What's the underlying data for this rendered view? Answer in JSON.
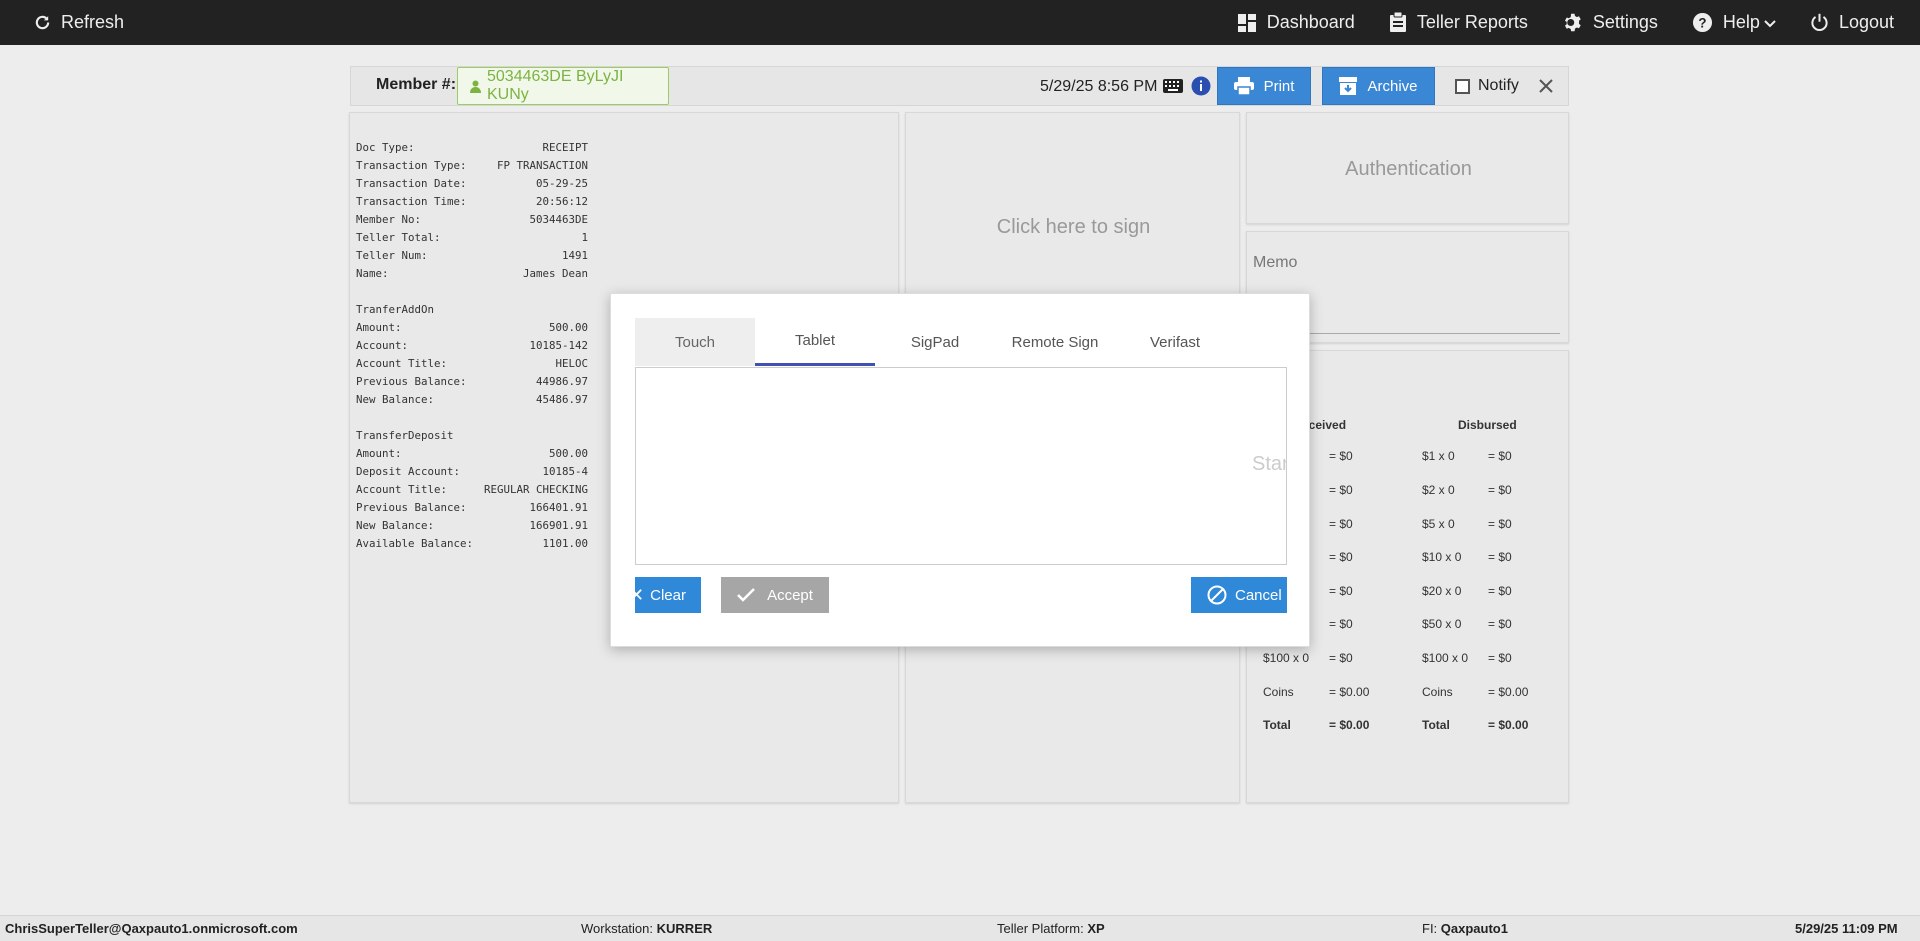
{
  "topbar": {
    "refresh_label": "Refresh",
    "nav": {
      "dashboard": "Dashboard",
      "teller_reports": "Teller Reports",
      "settings": "Settings",
      "help": "Help",
      "logout": "Logout"
    }
  },
  "member_bar": {
    "label": "Member #:",
    "member_chip": "5034463DE ByLyJI KUNy",
    "datetime": "5/29/25 8:56 PM",
    "print_label": "Print",
    "archive_label": "Archive",
    "notify_label": "Notify"
  },
  "receipt": {
    "rows1": [
      {
        "k": "Doc Type:",
        "v": "RECEIPT"
      },
      {
        "k": "Transaction Type:",
        "v": "FP TRANSACTION"
      },
      {
        "k": "Transaction Date:",
        "v": "05-29-25"
      },
      {
        "k": "Transaction Time:",
        "v": "20:56:12"
      },
      {
        "k": "Member No:",
        "v": "5034463DE"
      },
      {
        "k": "Teller Total:",
        "v": "1"
      },
      {
        "k": "Teller Num:",
        "v": "1491"
      },
      {
        "k": "Name:",
        "v": "James Dean"
      }
    ],
    "section2_title": "TranferAddOn",
    "rows2": [
      {
        "k": "Amount:",
        "v": "500.00"
      },
      {
        "k": "Account:",
        "v": "10185-142"
      },
      {
        "k": "Account Title:",
        "v": "HELOC"
      },
      {
        "k": "Previous Balance:",
        "v": "44986.97"
      },
      {
        "k": "New Balance:",
        "v": "45486.97"
      }
    ],
    "section3_title": "TransferDeposit",
    "rows3": [
      {
        "k": "Amount:",
        "v": "500.00"
      },
      {
        "k": "Deposit Account:",
        "v": "10185-4"
      },
      {
        "k": "Account Title:",
        "v": "REGULAR CHECKING"
      },
      {
        "k": "Previous Balance:",
        "v": "166401.91"
      },
      {
        "k": "New Balance:",
        "v": "166901.91"
      },
      {
        "k": "Available Balance:",
        "v": "1101.00"
      }
    ]
  },
  "sign_panel": {
    "click_to_sign": "Click here to sign"
  },
  "auth_panel": {
    "title": "Authentication"
  },
  "memo_panel": {
    "label": "Memo"
  },
  "cash_panel": {
    "received_header": "eceived",
    "disbursed_header": "Disbursed",
    "received": [
      {
        "label": "",
        "value": "= $0"
      },
      {
        "label": "",
        "value": "= $0"
      },
      {
        "label": "",
        "value": "= $0"
      },
      {
        "label": "",
        "value": "= $0"
      },
      {
        "label": "",
        "value": "= $0"
      },
      {
        "label": "",
        "value": "= $0"
      },
      {
        "label": "$100 x 0",
        "value": "= $0"
      },
      {
        "label": "Coins",
        "value": "= $0.00"
      },
      {
        "label": "Total",
        "value": "= $0.00"
      }
    ],
    "disbursed": [
      {
        "label": "$1 x 0",
        "value": "= $0"
      },
      {
        "label": "$2 x 0",
        "value": "= $0"
      },
      {
        "label": "$5 x 0",
        "value": "= $0"
      },
      {
        "label": "$10 x 0",
        "value": "= $0"
      },
      {
        "label": "$20 x 0",
        "value": "= $0"
      },
      {
        "label": "$50 x 0",
        "value": "= $0"
      },
      {
        "label": "$100 x 0",
        "value": "= $0"
      },
      {
        "label": "Coins",
        "value": "= $0.00"
      },
      {
        "label": "Total",
        "value": "= $0.00"
      }
    ]
  },
  "modal": {
    "tabs": [
      "Touch",
      "Tablet",
      "SigPad",
      "Remote Sign",
      "Verifast"
    ],
    "active_tab": "Touch",
    "selected_tab": "Tablet",
    "canvas_hint": "Star",
    "clear_label": "Clear",
    "accept_label": "Accept",
    "cancel_label": "Cancel"
  },
  "statusbar": {
    "user": "ChrisSuperTeller@Qaxpauto1.onmicrosoft.com",
    "workstation_label": "Workstation:",
    "workstation_value": "KURRER",
    "platform_label": "Teller Platform:",
    "platform_value": "XP",
    "fi_label": "FI:",
    "fi_value": "Qaxpauto1",
    "datetime": "5/29/25 11:09 PM"
  },
  "colors": {
    "topbar_bg": "#222222",
    "primary_button": "#3a87d5",
    "member_chip_green": "#7cb342",
    "tab_indicator": "#3f51b5",
    "accept_disabled": "#a6a6a6"
  }
}
